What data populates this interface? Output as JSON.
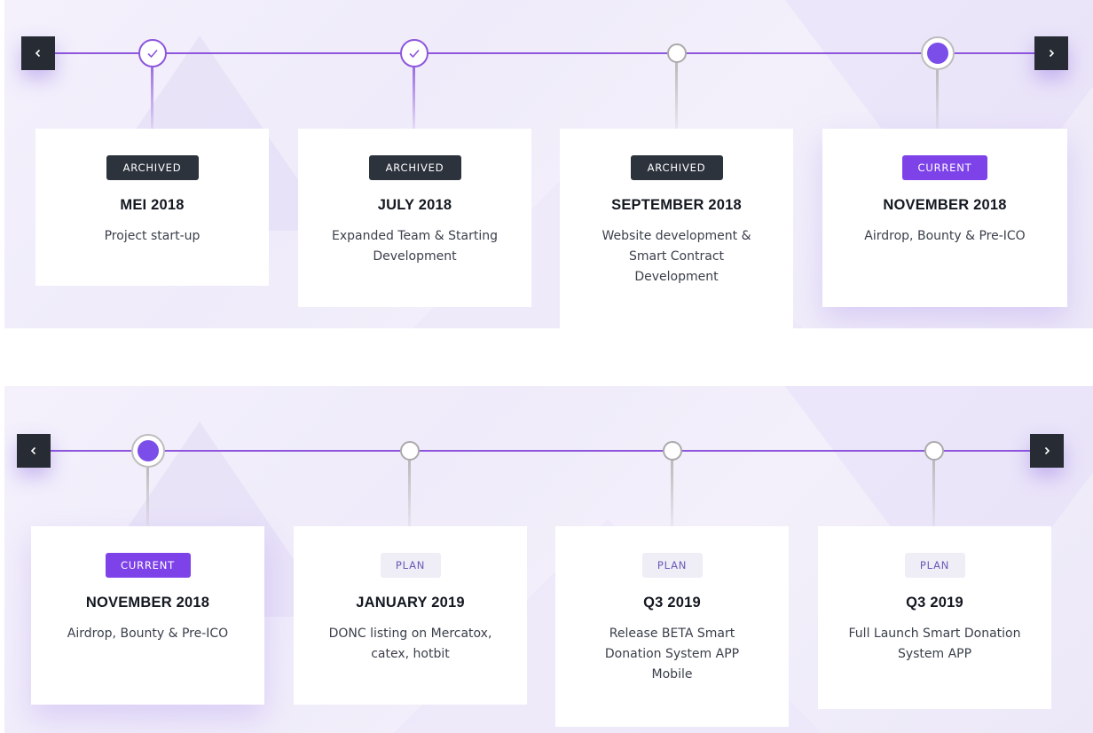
{
  "nav": {
    "prev_label": "‹",
    "next_label": "›"
  },
  "colors": {
    "accent": "#8d56dc",
    "current_badge": "#7e43e8",
    "archived_badge": "#2d333d",
    "plan_badge_bg": "#efedf6"
  },
  "roadmap_top": {
    "milestones": [
      {
        "status": "ARCHIVED",
        "date": "MEI 2018",
        "description": "Project start-up"
      },
      {
        "status": "ARCHIVED",
        "date": "JULY 2018",
        "description": "Expanded Team & Starting Development"
      },
      {
        "status": "ARCHIVED",
        "date": "SEPTEMBER 2018",
        "description": "Website development & Smart Contract Development"
      },
      {
        "status": "CURRENT",
        "date": "NOVEMBER 2018",
        "description": "Airdrop, Bounty & Pre-ICO"
      }
    ]
  },
  "roadmap_bottom": {
    "milestones": [
      {
        "status": "CURRENT",
        "date": "NOVEMBER 2018",
        "description": "Airdrop, Bounty & Pre-ICO"
      },
      {
        "status": "PLAN",
        "date": "JANUARY 2019",
        "description": "DONC listing on Mercatox, catex, hotbit"
      },
      {
        "status": "PLAN",
        "date": "Q3 2019",
        "description": "Release BETA Smart Donation System APP Mobile"
      },
      {
        "status": "PLAN",
        "date": "Q3 2019",
        "description": "Full Launch Smart Donation System APP"
      }
    ]
  }
}
